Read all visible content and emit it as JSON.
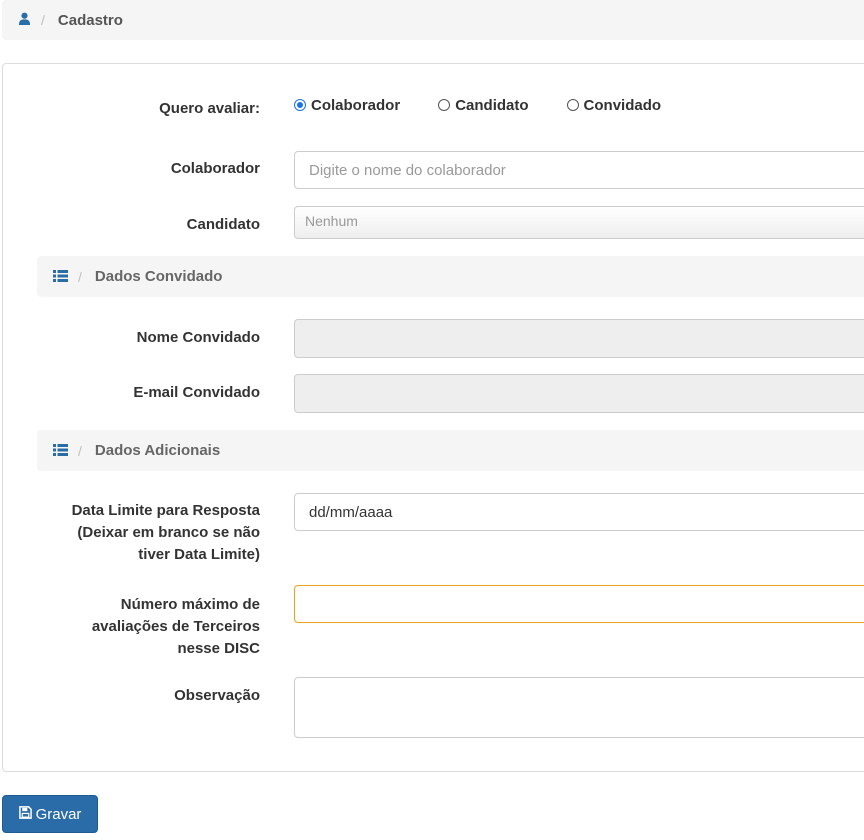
{
  "breadcrumb": {
    "separator": "/",
    "label": "Cadastro"
  },
  "form": {
    "quero_avaliar_label": "Quero avaliar:",
    "radio_options": [
      {
        "label": "Colaborador",
        "checked": true
      },
      {
        "label": "Candidato",
        "checked": false
      },
      {
        "label": "Convidado",
        "checked": false
      }
    ],
    "colaborador_label": "Colaborador",
    "colaborador_placeholder": "Digite o nome do colaborador",
    "candidato_label": "Candidato",
    "candidato_value": "Nenhum",
    "section_convidado": "Dados Convidado",
    "nome_convidado_label": "Nome Convidado",
    "email_convidado_label": "E-mail Convidado",
    "section_adicionais": "Dados Adicionais",
    "data_limite_label_lines": [
      "Data Limite para Resposta",
      "(Deixar em branco se não",
      "tiver Data Limite)"
    ],
    "data_limite_value": "dd/mm/aaaa",
    "numero_maximo_label_lines": [
      "Número máximo de",
      "avaliações de Terceiros",
      "nesse DISC"
    ],
    "observacao_label": "Observação"
  },
  "actions": {
    "gravar_label": "Gravar"
  },
  "colors": {
    "accent": "#2a6ca8",
    "radio_checked": "#1a73e8",
    "warning_border": "#e8a317"
  },
  "icons": {
    "breadcrumb": "user-icon",
    "section": "list-icon",
    "save": "floppy-disk-icon"
  }
}
